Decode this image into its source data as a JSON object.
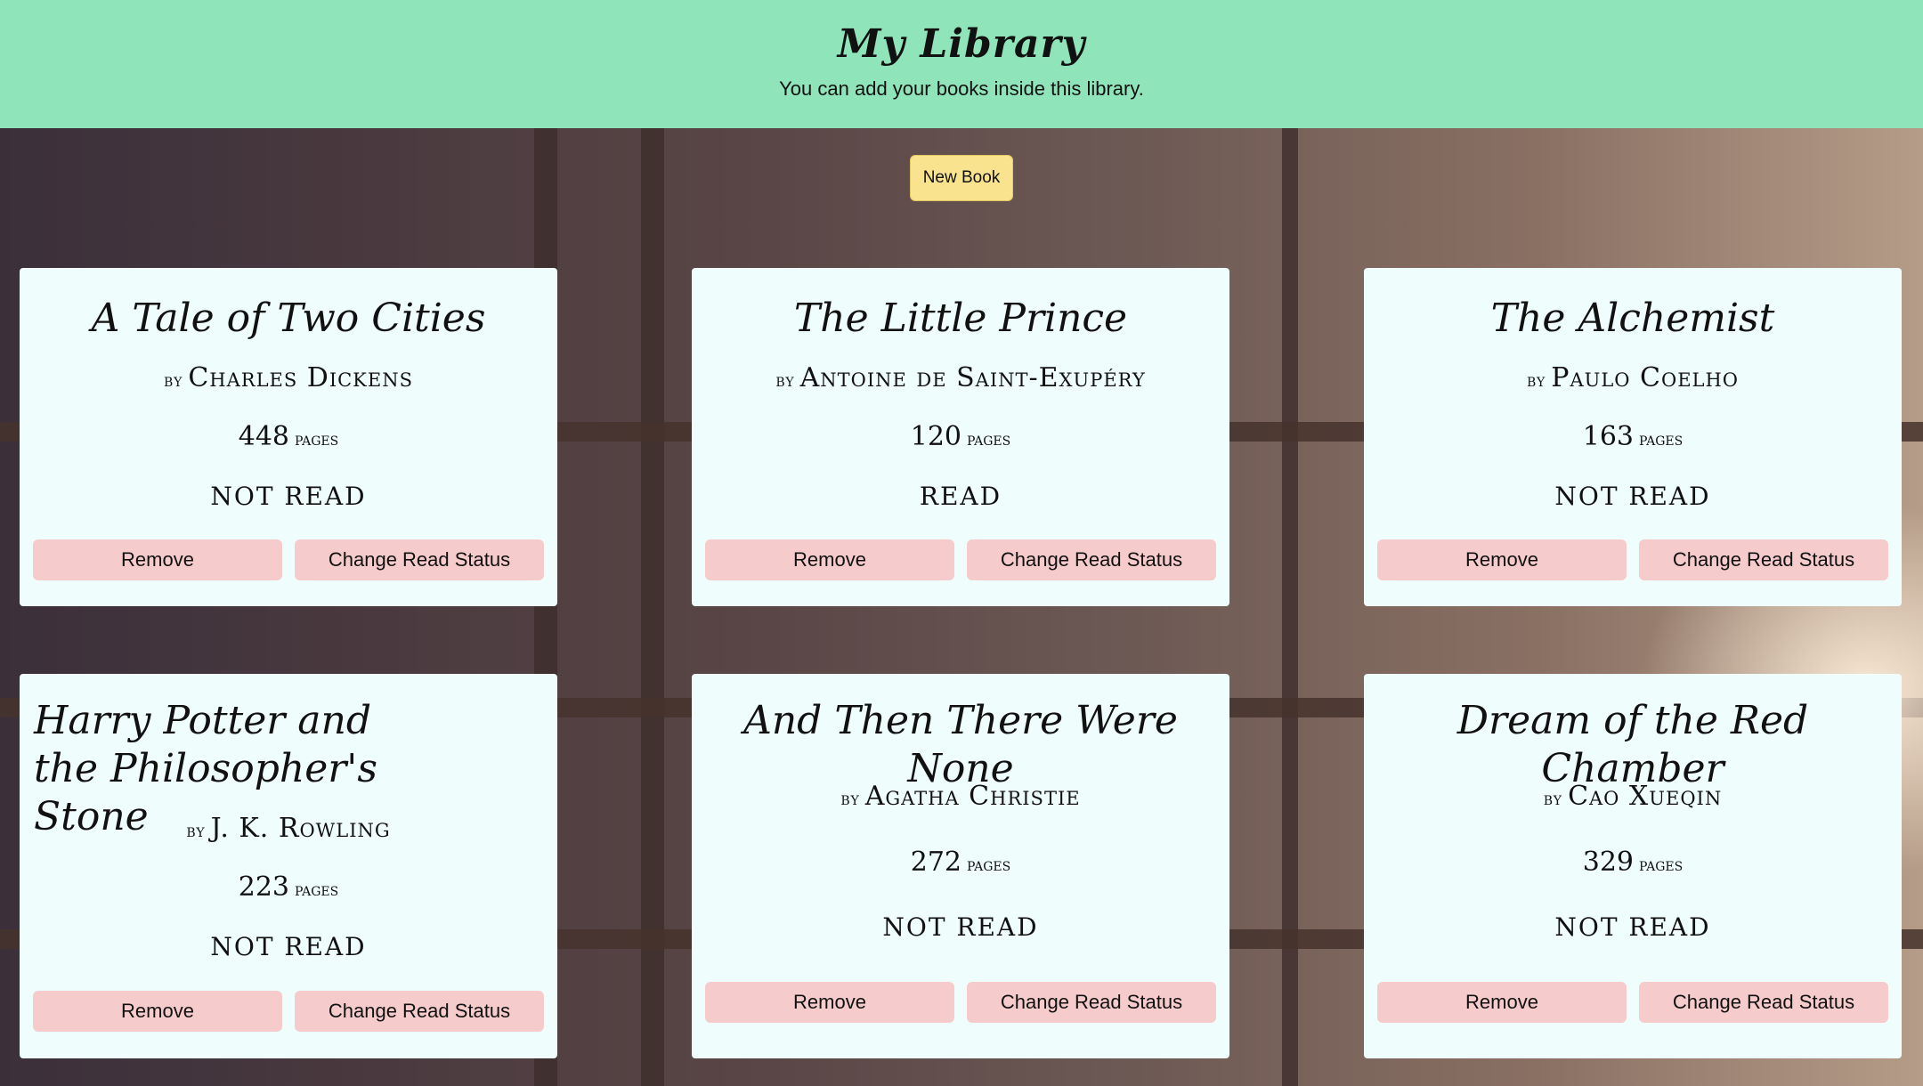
{
  "header": {
    "title": "My Library",
    "subtitle": "You can add your books inside this library."
  },
  "new_book_label": "New Book",
  "card_labels": {
    "by": "by",
    "pages_unit": "pages",
    "remove": "Remove",
    "change_status": "Change Read Status"
  },
  "books": [
    {
      "title": "A Tale of Two Cities",
      "author": "Charles Dickens",
      "pages": "448",
      "status": "NOT READ"
    },
    {
      "title": "The Little Prince",
      "author": "Antoine de Saint-Exupéry",
      "pages": "120",
      "status": "READ"
    },
    {
      "title": "The Alchemist",
      "author": "Paulo Coelho",
      "pages": "163",
      "status": "NOT READ"
    },
    {
      "title": "Harry Potter and the Philosopher's Stone",
      "author": "J. K. Rowling",
      "pages": "223",
      "status": "NOT READ"
    },
    {
      "title": "And Then There Were None",
      "author": "Agatha Christie",
      "pages": "272",
      "status": "NOT READ"
    },
    {
      "title": "Dream of the Red Chamber",
      "author": "Cao Xueqin",
      "pages": "329",
      "status": "NOT READ"
    }
  ],
  "colors": {
    "header_bg": "#90e4ba",
    "card_bg": "#f0fdfd",
    "button_bg": "#f6cbcb",
    "new_book_bg": "#f9e38e"
  }
}
